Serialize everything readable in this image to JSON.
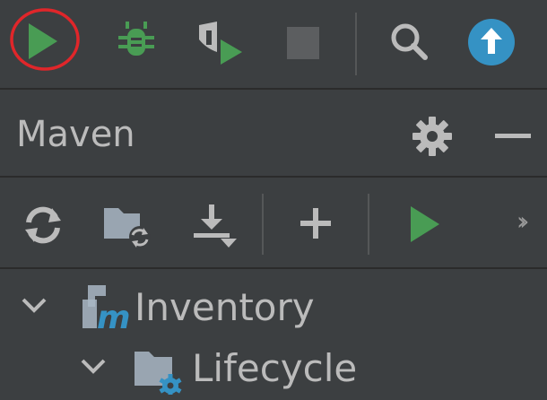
{
  "toolbar": {
    "run_icon": "run-icon",
    "debug_icon": "debug-icon",
    "coverage_icon": "run-with-coverage-icon",
    "stop_icon": "stop-icon",
    "search_icon": "search-icon",
    "update_icon": "update-icon"
  },
  "maven_panel": {
    "title": "Maven",
    "settings_icon": "gear-icon",
    "hide_icon": "minimize-icon",
    "actions": {
      "reload_icon": "reload-icon",
      "generate_sources_icon": "folder-refresh-icon",
      "download_icon": "download-icon",
      "add_icon": "add-icon",
      "run_icon": "run-icon",
      "more_icon": "more-chevrons-icon",
      "more_label": "››"
    }
  },
  "tree": {
    "nodes": [
      {
        "label": "Inventory",
        "icon": "maven-module-icon",
        "expanded": true,
        "level": 0
      },
      {
        "label": "Lifecycle",
        "icon": "lifecycle-folder-icon",
        "expanded": true,
        "level": 1
      }
    ]
  },
  "colors": {
    "run_green": "#499c54",
    "highlight_circle": "#e0262a",
    "update_blue": "#3592c4",
    "background": "#3c3f41"
  }
}
